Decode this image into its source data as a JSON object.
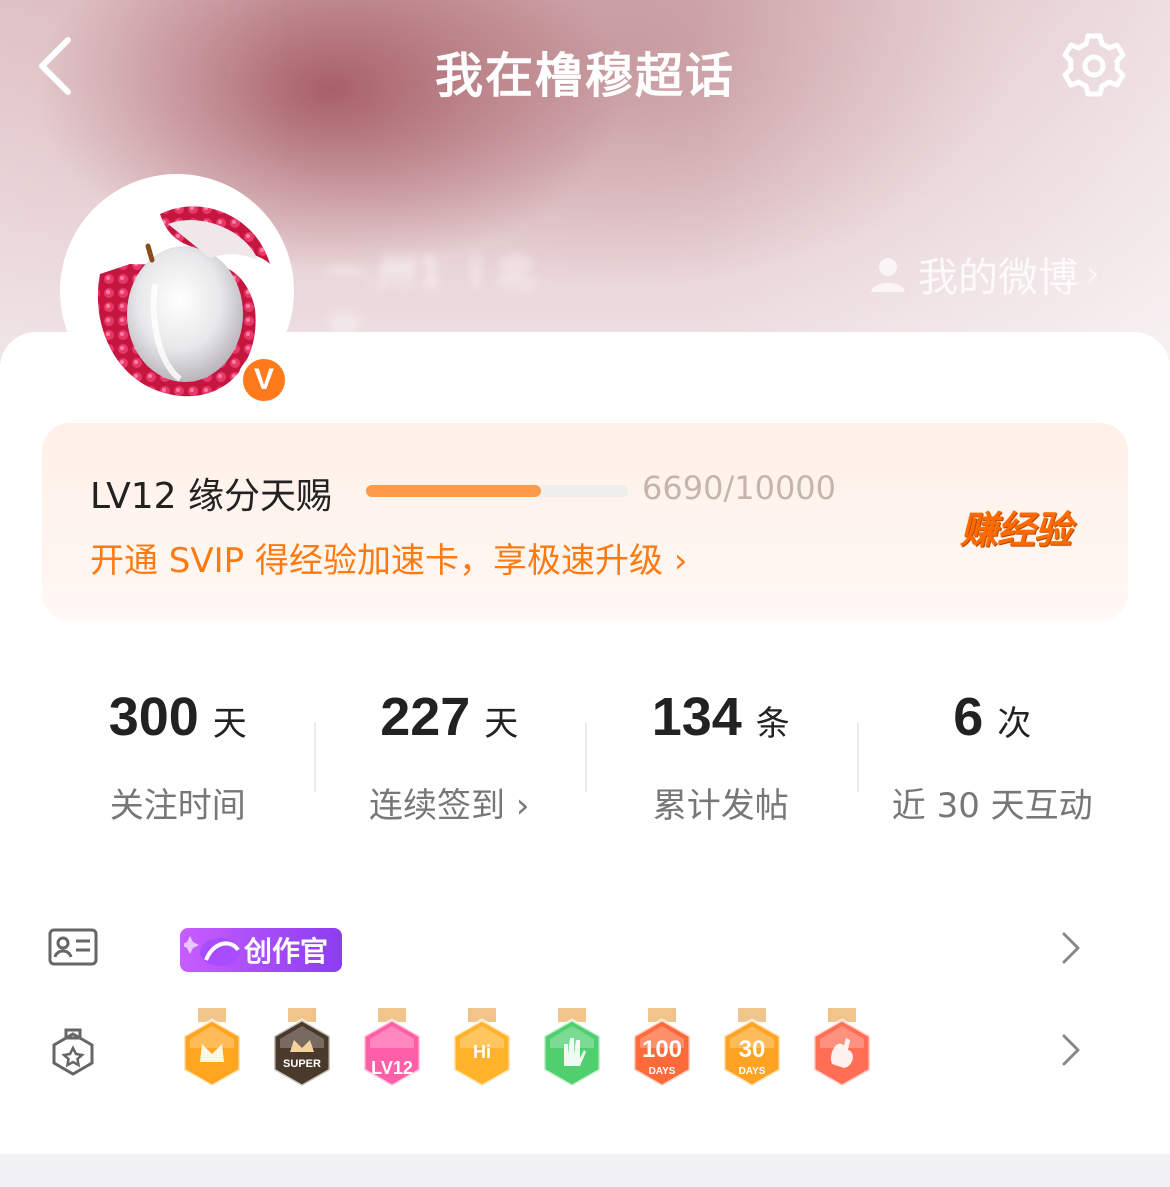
{
  "header": {
    "title": "我在橹穆超话",
    "back_icon": "chevron-left-icon",
    "settings_icon": "gear-icon",
    "my_weibo_label": "我的微博"
  },
  "profile": {
    "username": "一.卅1 丨北北.",
    "verified_badge": "V"
  },
  "level": {
    "name": "LV12 缘分天赐",
    "progress_current": 6690,
    "progress_max": 10000,
    "progress_text": "6690/10000",
    "svip_promo": "开通 SVIP 得经验加速卡，享极速升级",
    "earn_exp_label": "赚经验",
    "accent_color": "#ff7b12"
  },
  "stats": [
    {
      "value": "300",
      "unit": "天",
      "label": "关注时间",
      "has_arrow": false
    },
    {
      "value": "227",
      "unit": "天",
      "label": "连续签到",
      "has_arrow": true
    },
    {
      "value": "134",
      "unit": "条",
      "label": "累计发帖",
      "has_arrow": false
    },
    {
      "value": "6",
      "unit": "次",
      "label": "近 30 天互动",
      "has_arrow": false
    }
  ],
  "identity": {
    "icon": "id-card-icon",
    "tag_label": "创作官"
  },
  "medals": {
    "icon": "medal-outline-icon",
    "items": [
      {
        "name": "crown-medal",
        "color": "#ffa51f",
        "text": ""
      },
      {
        "name": "super-medal",
        "color": "#4a3a2c",
        "text": "SUPER"
      },
      {
        "name": "lv12-medal",
        "color": "#ff5fa8",
        "text": "LV12"
      },
      {
        "name": "hi-medal",
        "color": "#ffb32a",
        "text": "Hi"
      },
      {
        "name": "hand-medal",
        "color": "#4fcf6e",
        "text": ""
      },
      {
        "name": "100days-medal",
        "color": "#ff6a3a",
        "text": "100",
        "sub": "DAYS"
      },
      {
        "name": "30days-medal",
        "color": "#ffa323",
        "text": "30",
        "sub": "DAYS"
      },
      {
        "name": "rock-medal",
        "color": "#ff6e55",
        "text": ""
      }
    ]
  }
}
